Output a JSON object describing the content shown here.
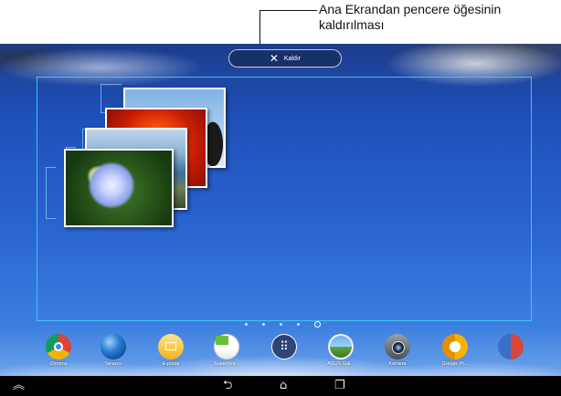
{
  "annotation": {
    "text": "Ana Ekrandan pencere öğesinin kaldırılması"
  },
  "remove_bar": {
    "icon": "close-icon",
    "label": "Kaldır"
  },
  "dock": {
    "apps": [
      {
        "label": "Chrome",
        "icon": "chrome-icon"
      },
      {
        "label": "Tarayıcı",
        "icon": "globe-icon"
      },
      {
        "label": "E-posta",
        "icon": "mail-icon"
      },
      {
        "label": "SuperNot...",
        "icon": "notes-icon"
      },
      {
        "label": "",
        "icon": "apps-grid-icon"
      },
      {
        "label": "ASUS Gal...",
        "icon": "gallery-icon"
      },
      {
        "label": "Kamera",
        "icon": "camera-icon"
      },
      {
        "label": "Google Pl...",
        "icon": "music-icon"
      },
      {
        "label": "",
        "icon": "google-apps-icon"
      }
    ]
  },
  "page_indicator": {
    "pages": 5,
    "current": 5
  },
  "navbar": {
    "buttons": [
      "hide-bar-icon",
      "back-icon",
      "home-icon",
      "recent-apps-icon"
    ]
  }
}
